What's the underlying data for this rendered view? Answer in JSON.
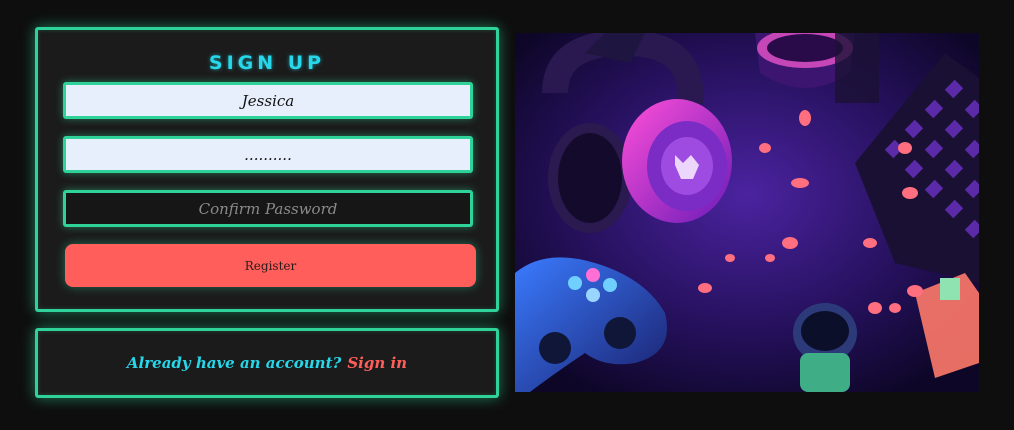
{
  "signup": {
    "title": "SIGN UP",
    "username_value": "Jessica",
    "password_value": "..........",
    "confirm_placeholder": "Confirm Password",
    "register_label": "Register"
  },
  "signin": {
    "prompt": "Already have an account?",
    "link": "Sign in"
  },
  "hero": {
    "alt": "Gaming setup with headset, controller, keyboard and candies in purple neon light"
  },
  "colors": {
    "accent_green": "#2fd39a",
    "title_cyan": "#27d7ea",
    "button_coral": "#ff5e5b",
    "background": "#0e0e0e",
    "card": "#1b1b1b"
  }
}
